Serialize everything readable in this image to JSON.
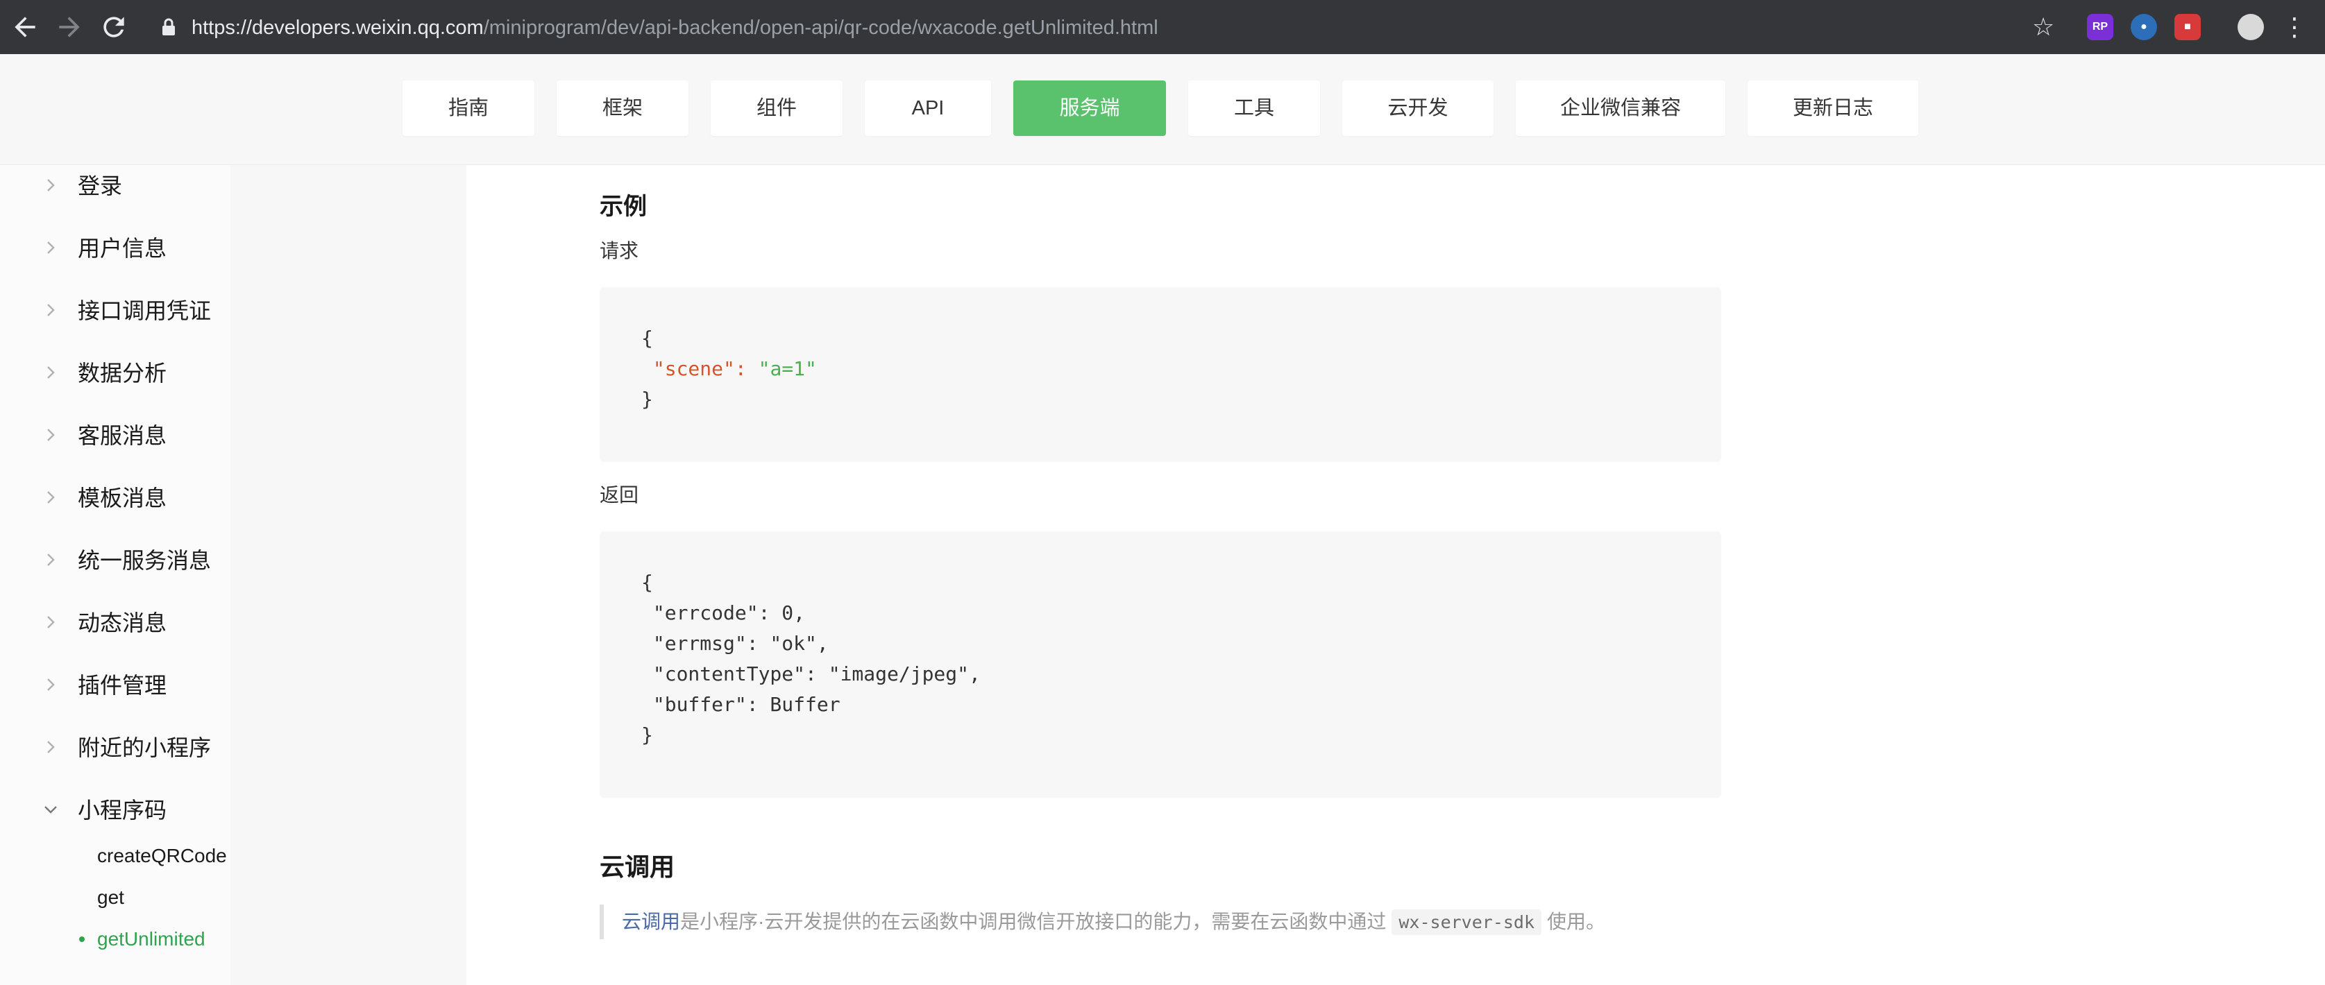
{
  "browser": {
    "url_host": "https://developers.weixin.qq.com",
    "url_path": "/miniprogram/dev/api-backend/open-api/qr-code/wxacode.getUnlimited.html"
  },
  "topnav": {
    "tabs": [
      {
        "label": "指南"
      },
      {
        "label": "框架"
      },
      {
        "label": "组件"
      },
      {
        "label": "API"
      },
      {
        "label": "服务端",
        "active": true
      },
      {
        "label": "工具"
      },
      {
        "label": "云开发"
      },
      {
        "label": "企业微信兼容"
      },
      {
        "label": "更新日志"
      }
    ]
  },
  "sidebar": {
    "items": [
      {
        "label": "登录"
      },
      {
        "label": "用户信息"
      },
      {
        "label": "接口调用凭证"
      },
      {
        "label": "数据分析"
      },
      {
        "label": "客服消息"
      },
      {
        "label": "模板消息"
      },
      {
        "label": "统一服务消息"
      },
      {
        "label": "动态消息"
      },
      {
        "label": "插件管理"
      },
      {
        "label": "附近的小程序"
      },
      {
        "label": "小程序码",
        "expanded": true
      }
    ],
    "sub_items": [
      {
        "label": "createQRCode"
      },
      {
        "label": "get"
      },
      {
        "label": "getUnlimited",
        "active": true
      }
    ]
  },
  "content": {
    "example_title": "示例",
    "request_label": "请求",
    "request_code": {
      "open": "{",
      "key": "\"scene\"",
      "colon": ": ",
      "value": "\"a=1\"",
      "close": "}"
    },
    "response_label": "返回",
    "response_code": [
      "{",
      " \"errcode\": 0,",
      " \"errmsg\": \"ok\",",
      " \"contentType\": \"image/jpeg\",",
      " \"buffer\": Buffer",
      "}"
    ],
    "cloud_title": "云调用",
    "cloud_quote": {
      "link": "云调用",
      "text_before": "是小程序·云开发提供的在云函数中调用微信开放接口的能力，需要在云函数中通过",
      "code": "wx-server-sdk",
      "text_after": "使用。"
    }
  }
}
